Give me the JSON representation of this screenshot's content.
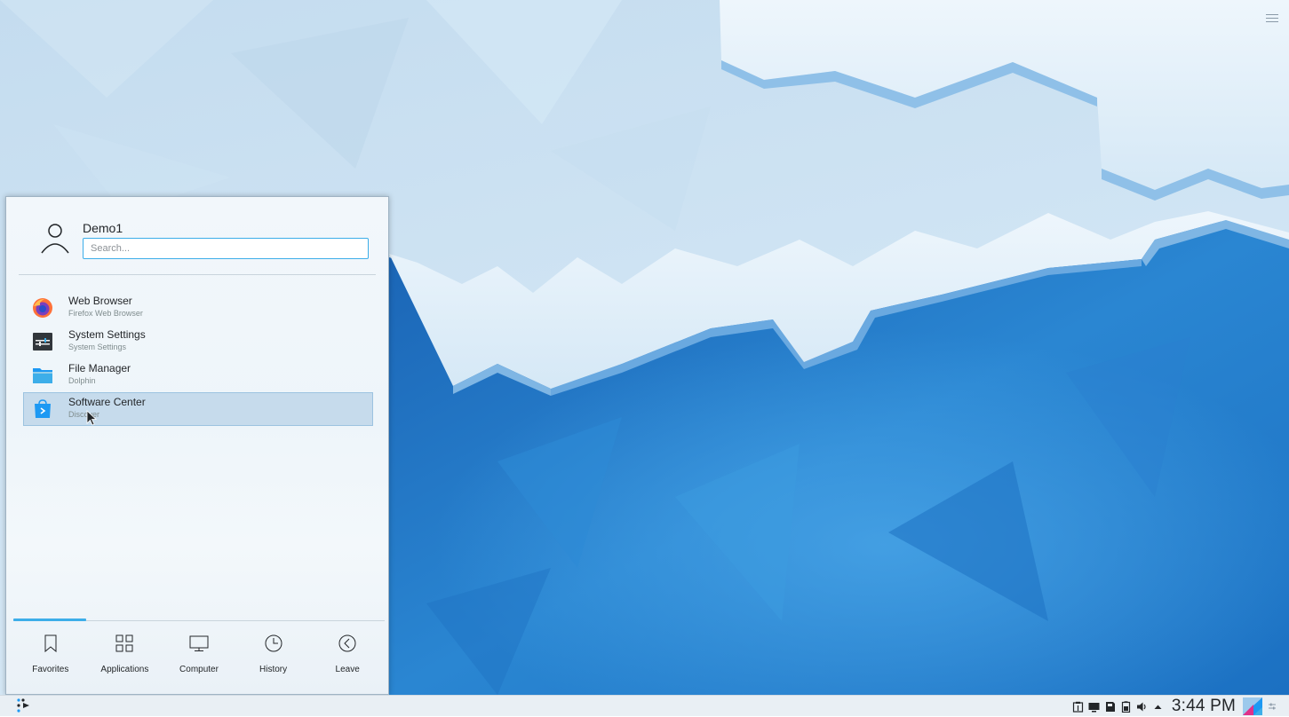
{
  "launcher": {
    "user_name": "Demo1",
    "search_placeholder": "Search...",
    "favorites": [
      {
        "name": "Web Browser",
        "description": "Firefox Web Browser",
        "icon": "firefox-icon"
      },
      {
        "name": "System Settings",
        "description": "System Settings",
        "icon": "system-settings-icon"
      },
      {
        "name": "File Manager",
        "description": "Dolphin",
        "icon": "folder-icon"
      },
      {
        "name": "Software Center",
        "description": "Discover",
        "icon": "discover-icon",
        "selected": true
      }
    ],
    "tabs": [
      {
        "label": "Favorites",
        "icon": "bookmark-icon",
        "active": true
      },
      {
        "label": "Applications",
        "icon": "grid-icon"
      },
      {
        "label": "Computer",
        "icon": "monitor-icon"
      },
      {
        "label": "History",
        "icon": "clock-icon"
      },
      {
        "label": "Leave",
        "icon": "leave-icon"
      }
    ]
  },
  "taskbar": {
    "clock": "3:44 PM",
    "tray_icons": [
      "clipboard-icon",
      "display-icon",
      "devices-icon",
      "battery-icon",
      "volume-icon",
      "expand-tray-icon"
    ]
  },
  "colors": {
    "accent": "#3daee9",
    "selection": "#c6dbec",
    "wallpaper_light": "#cfe5f6",
    "wallpaper_dark": "#1d6fbf"
  }
}
